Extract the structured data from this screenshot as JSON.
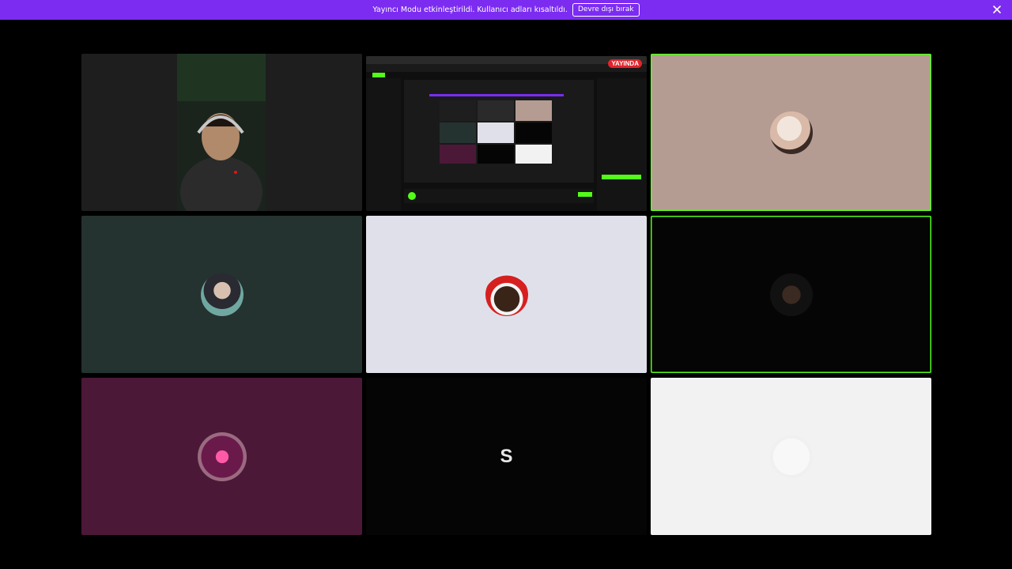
{
  "banner": {
    "message": "Yayıncı Modu etkinleştirildi. Kullanıcı adları kısaltıldı.",
    "button": "Devre dışı bırak"
  },
  "tiles": [
    {
      "kind": "camera"
    },
    {
      "kind": "screen-share",
      "live_badge": "YAYINDA"
    },
    {
      "kind": "avatar",
      "speaking": true
    },
    {
      "kind": "avatar",
      "speaking": false
    },
    {
      "kind": "avatar",
      "speaking": false
    },
    {
      "kind": "avatar",
      "speaking": true
    },
    {
      "kind": "avatar",
      "speaking": false
    },
    {
      "kind": "letter",
      "letter": "S"
    },
    {
      "kind": "avatar",
      "speaking": false
    }
  ],
  "colors": {
    "banner": "#7b2cf0",
    "speaking_border": "#53fc18",
    "live_badge": "#e0242b"
  }
}
